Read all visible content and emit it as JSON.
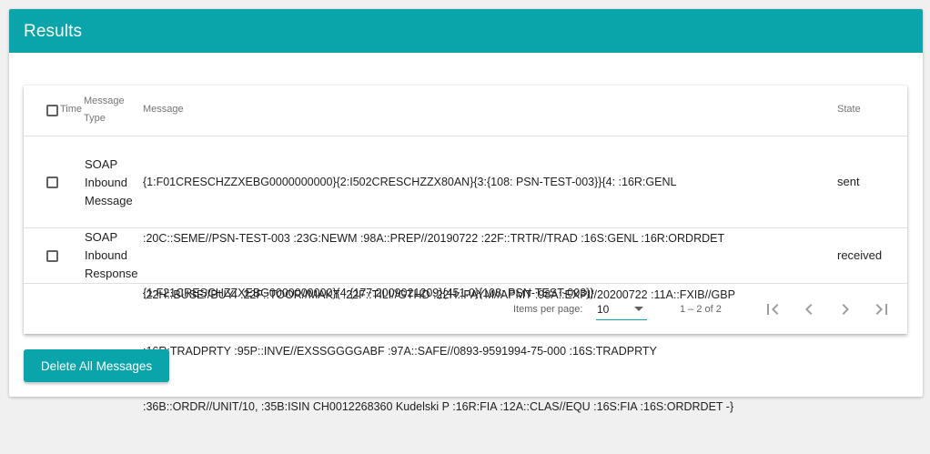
{
  "panel": {
    "title": "Results"
  },
  "table": {
    "columns": {
      "time": "Time",
      "message_type_line1": "Message",
      "message_type_line2": "Type",
      "message": "Message",
      "state": "State"
    },
    "rows": [
      {
        "type_lines": [
          "SOAP",
          "Inbound",
          "Message"
        ],
        "message_lines": [
          "{1:F01CRESCHZZXEBG0000000000}{2:I502CRESCHZZX80AN}{3:{108: PSN-TEST-003}}{4: :16R:GENL",
          ":20C::SEME//PSN-TEST-003 :23G:NEWM :98A::PREP//20190722 :22F::TRTR//TRAD :16S:GENL :16R:ORDRDET",
          ":22H::BUSE//BUYI :22F::TOOR//MAKT :22F::TILI//GTHD :22H::PAYM//APMT :98A::EXPI//20200722 :11A::FXIB//GBP",
          ":16R:TRADPRTY :95P::INVE//EXSSGGGGABF :97A::SAFE//0893-9591994-75-000 :16S:TRADPRTY",
          ":36B::ORDR//UNIT/10, :35B:ISIN CH0012268360 Kudelski P :16R:FIA :12A::CLAS//EQU :16S:FIA :16S:ORDRDET -}"
        ],
        "state": "sent"
      },
      {
        "type_lines": [
          "SOAP",
          "Inbound",
          "Response"
        ],
        "message_lines": [
          "{1:F21CRESCHZZXEBG0000000000}{4:{177:2009021209}{451:0}{108: PSN-TEST-003}}"
        ],
        "state": "received"
      }
    ]
  },
  "paginator": {
    "items_per_page_label": "Items per page:",
    "page_size": "10",
    "range_label": "1 – 2 of 2"
  },
  "actions": {
    "delete_all_label": "Delete All Messages"
  },
  "colors": {
    "accent": "#0aa5aa"
  }
}
